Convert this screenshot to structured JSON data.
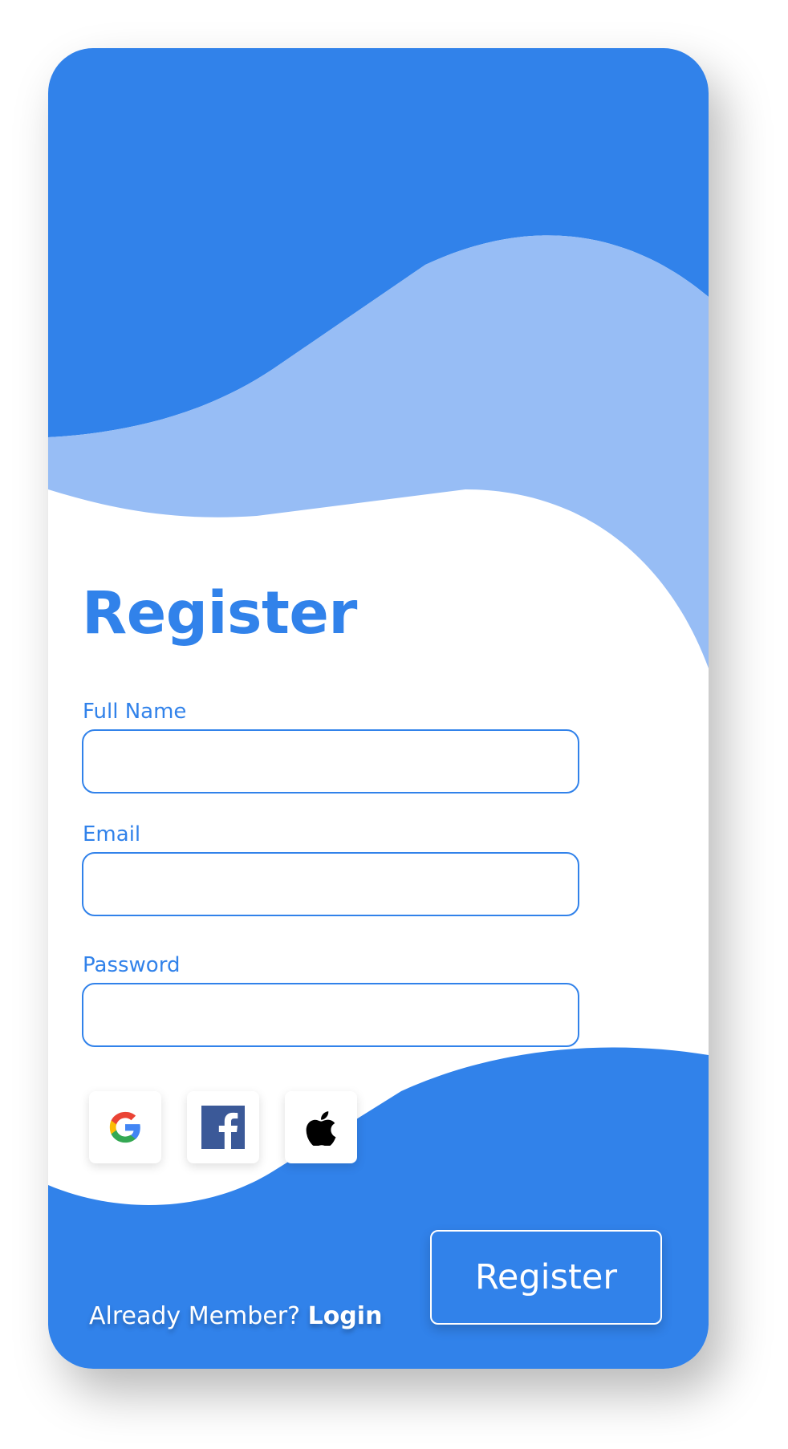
{
  "colors": {
    "primary": "#3182ea",
    "light_wave": "#97bdf5",
    "background": "#ffffff",
    "facebook": "#3b5998"
  },
  "form": {
    "title": "Register",
    "fields": [
      {
        "label": "Full Name",
        "value": "",
        "placeholder": ""
      },
      {
        "label": "Email",
        "value": "",
        "placeholder": ""
      },
      {
        "label": "Password",
        "value": "",
        "placeholder": ""
      }
    ]
  },
  "social": [
    {
      "icon": "google-icon"
    },
    {
      "icon": "facebook-icon"
    },
    {
      "icon": "apple-icon"
    }
  ],
  "actions": {
    "register_label": "Register"
  },
  "footer": {
    "prompt": "Already Member?",
    "login_label": "Login"
  }
}
